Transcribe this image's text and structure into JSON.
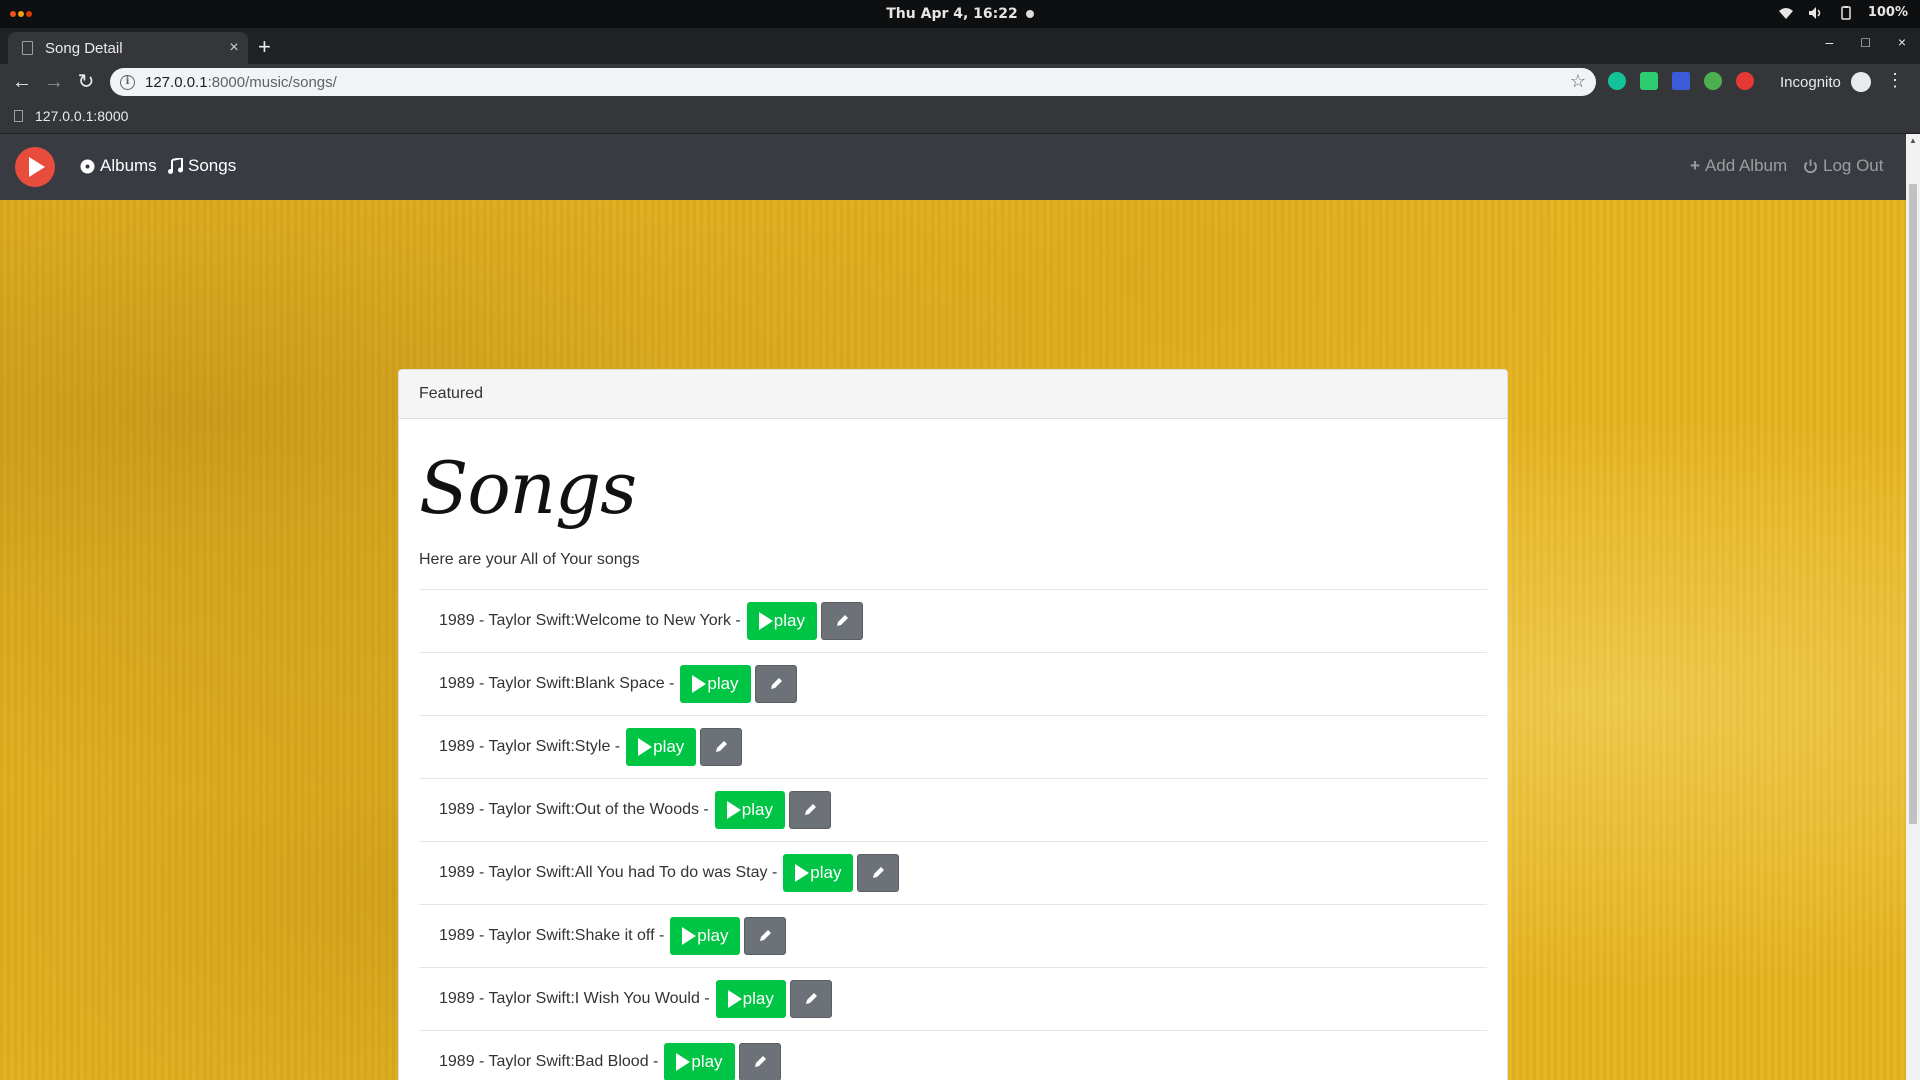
{
  "os": {
    "clock": "Thu Apr  4, 16:22",
    "battery": "100%"
  },
  "browser": {
    "tab_title": "Song Detail",
    "tab_close": "×",
    "new_tab": "+",
    "url_host": "127.0.0.1",
    "url_path": ":8000/music/songs/",
    "incognito_label": "Incognito",
    "bookmark_label": "127.0.0.1:8000"
  },
  "navbar": {
    "albums_label": "Albums",
    "songs_label": "Songs",
    "add_album_label": "Add Album",
    "logout_label": "Log Out"
  },
  "panel": {
    "heading": "Featured",
    "title": "Songs",
    "subtitle": "Here are your All of Your songs",
    "play_label": "play",
    "songs": [
      "1989 - Taylor Swift:Welcome to New York -",
      "1989 - Taylor Swift:Blank Space -",
      "1989 - Taylor Swift:Style -",
      "1989 - Taylor Swift:Out of the Woods -",
      "1989 - Taylor Swift:All You had To do was Stay -",
      "1989 - Taylor Swift:Shake it off -",
      "1989 - Taylor Swift:I Wish You Would -",
      "1989 - Taylor Swift:Bad Blood -"
    ]
  },
  "colors": {
    "play_green": "#00c444",
    "edit_gray": "#6c7278",
    "navbar_bg": "#383c42",
    "brand_red": "#e74c3c",
    "background_yellow": "#e6b420"
  }
}
